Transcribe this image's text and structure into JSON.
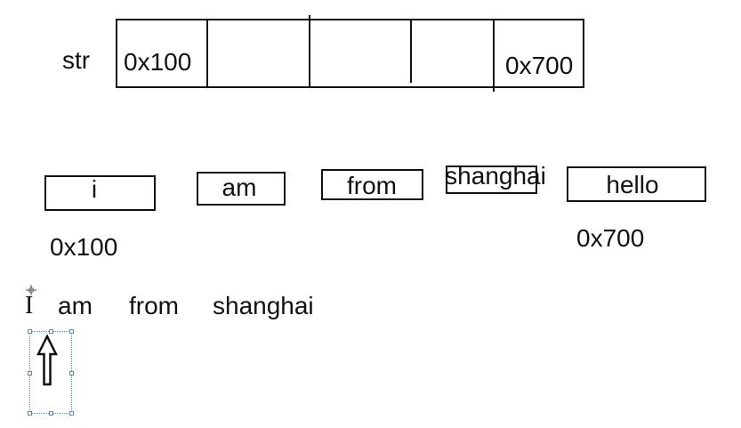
{
  "pointer_array": {
    "name_label": "str",
    "first_cell": "0x100",
    "last_cell": "0x700"
  },
  "words": [
    {
      "text": "i"
    },
    {
      "text": "am"
    },
    {
      "text": "from"
    },
    {
      "text": "shanghai"
    },
    {
      "text": "hello"
    }
  ],
  "addresses": {
    "first_word": "0x100",
    "last_word": "0x700"
  },
  "sentence": {
    "first": "I",
    "words": [
      "am",
      "from",
      "shanghai"
    ]
  },
  "icons": {
    "cursor": "text-cursor-icon",
    "arrow": "up-arrow-icon"
  }
}
